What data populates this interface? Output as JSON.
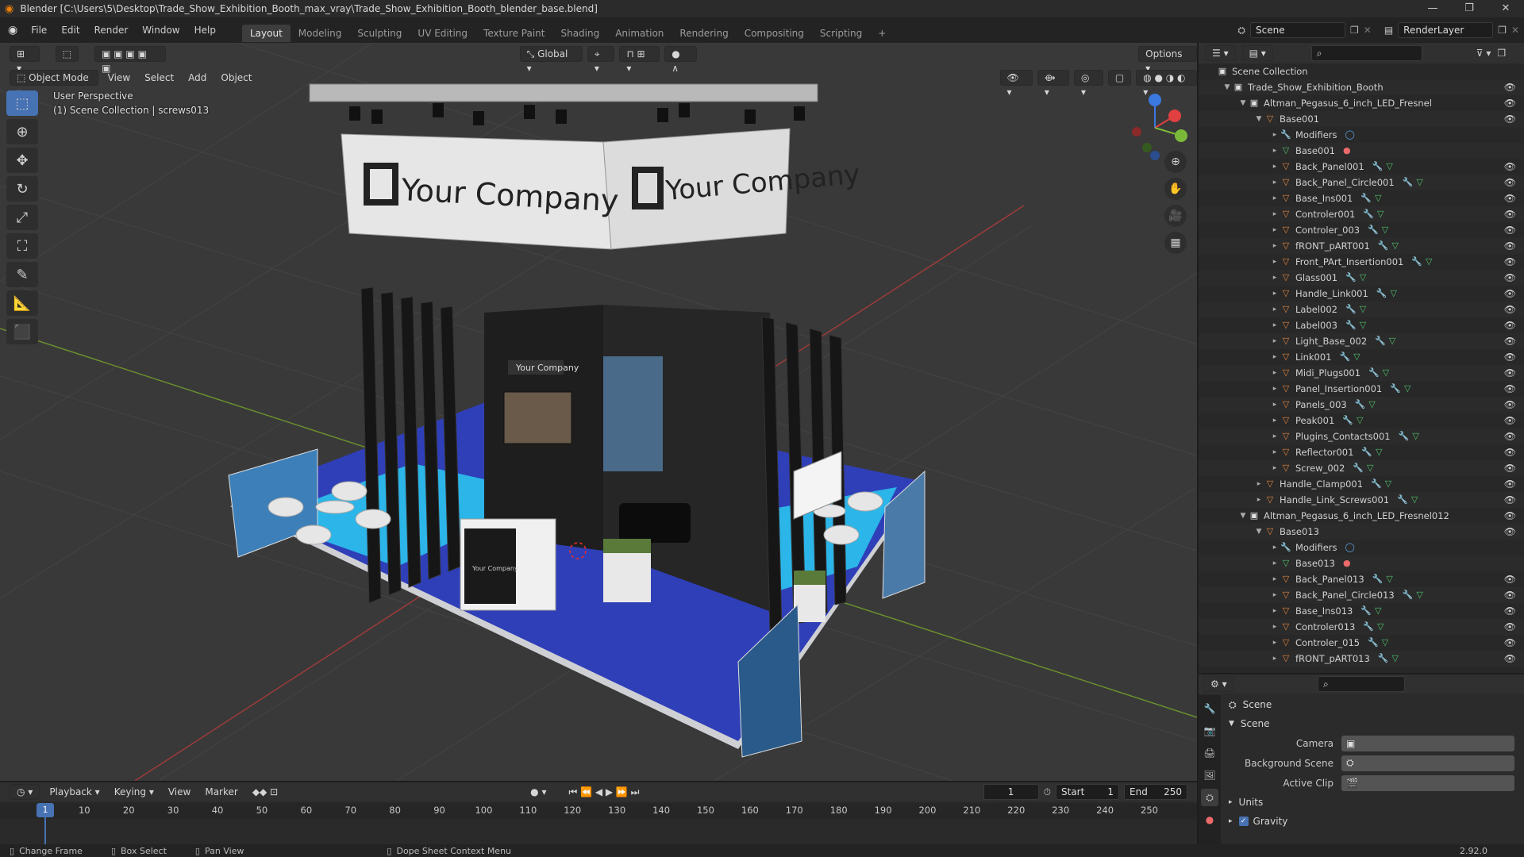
{
  "window": {
    "title": "Blender [C:\\Users\\5\\Desktop\\Trade_Show_Exhibition_Booth_max_vray\\Trade_Show_Exhibition_Booth_blender_base.blend]",
    "controls": [
      "—",
      "❐",
      "✕"
    ]
  },
  "menubar": {
    "menus": [
      "File",
      "Edit",
      "Render",
      "Window",
      "Help"
    ],
    "workspaces": [
      "Layout",
      "Modeling",
      "Sculpting",
      "UV Editing",
      "Texture Paint",
      "Shading",
      "Animation",
      "Rendering",
      "Compositing",
      "Scripting"
    ],
    "active_workspace": "Layout",
    "add_tab": "+",
    "scene": "Scene",
    "view_layer": "RenderLayer"
  },
  "viewport": {
    "transform_orientation": "Global",
    "options": "Options",
    "mode": "Object Mode",
    "menus": [
      "View",
      "Select",
      "Add",
      "Object"
    ],
    "overlay_line1": "User Perspective",
    "overlay_line2": "(1) Scene Collection | screws013",
    "banner_text_left": "Your Company",
    "banner_text_right": "Your Company",
    "sign_text": "Your Company",
    "desk_text": "Your Company"
  },
  "outliner": {
    "rows": [
      {
        "depth": 0,
        "tri": "",
        "icon": "coll",
        "label": "Scene Collection",
        "eye": false
      },
      {
        "depth": 1,
        "tri": "▼",
        "icon": "coll",
        "label": "Trade_Show_Exhibition_Booth",
        "eye": true
      },
      {
        "depth": 2,
        "tri": "▼",
        "icon": "coll",
        "label": "Altman_Pegasus_6_inch_LED_Fresnel",
        "eye": true
      },
      {
        "depth": 3,
        "tri": "▼",
        "icon": "obj",
        "label": "Base001",
        "eye": true
      },
      {
        "depth": 4,
        "tri": "▸",
        "icon": "mod",
        "label": "Modifiers",
        "eye": false,
        "badge": "mod"
      },
      {
        "depth": 4,
        "tri": "▸",
        "icon": "mesh",
        "label": "Base001",
        "eye": false,
        "badge": "mat"
      },
      {
        "depth": 4,
        "tri": "▸",
        "icon": "obj",
        "label": "Back_Panel001",
        "eye": true,
        "badge": "std"
      },
      {
        "depth": 4,
        "tri": "▸",
        "icon": "obj",
        "label": "Back_Panel_Circle001",
        "eye": true,
        "badge": "std"
      },
      {
        "depth": 4,
        "tri": "▸",
        "icon": "obj",
        "label": "Base_Ins001",
        "eye": true,
        "badge": "std"
      },
      {
        "depth": 4,
        "tri": "▸",
        "icon": "obj",
        "label": "Controler001",
        "eye": true,
        "badge": "std"
      },
      {
        "depth": 4,
        "tri": "▸",
        "icon": "obj",
        "label": "Controler_003",
        "eye": true,
        "badge": "std"
      },
      {
        "depth": 4,
        "tri": "▸",
        "icon": "obj",
        "label": "fRONT_pART001",
        "eye": true,
        "badge": "std"
      },
      {
        "depth": 4,
        "tri": "▸",
        "icon": "obj",
        "label": "Front_PArt_Insertion001",
        "eye": true,
        "badge": "std"
      },
      {
        "depth": 4,
        "tri": "▸",
        "icon": "obj",
        "label": "Glass001",
        "eye": true,
        "badge": "std"
      },
      {
        "depth": 4,
        "tri": "▸",
        "icon": "obj",
        "label": "Handle_Link001",
        "eye": true,
        "badge": "std"
      },
      {
        "depth": 4,
        "tri": "▸",
        "icon": "obj",
        "label": "Label002",
        "eye": true,
        "badge": "std"
      },
      {
        "depth": 4,
        "tri": "▸",
        "icon": "obj",
        "label": "Label003",
        "eye": true,
        "badge": "std"
      },
      {
        "depth": 4,
        "tri": "▸",
        "icon": "obj",
        "label": "Light_Base_002",
        "eye": true,
        "badge": "std"
      },
      {
        "depth": 4,
        "tri": "▸",
        "icon": "obj",
        "label": "Link001",
        "eye": true,
        "badge": "std"
      },
      {
        "depth": 4,
        "tri": "▸",
        "icon": "obj",
        "label": "Midi_Plugs001",
        "eye": true,
        "badge": "std"
      },
      {
        "depth": 4,
        "tri": "▸",
        "icon": "obj",
        "label": "Panel_Insertion001",
        "eye": true,
        "badge": "std"
      },
      {
        "depth": 4,
        "tri": "▸",
        "icon": "obj",
        "label": "Panels_003",
        "eye": true,
        "badge": "std"
      },
      {
        "depth": 4,
        "tri": "▸",
        "icon": "obj",
        "label": "Peak001",
        "eye": true,
        "badge": "std"
      },
      {
        "depth": 4,
        "tri": "▸",
        "icon": "obj",
        "label": "Plugins_Contacts001",
        "eye": true,
        "badge": "std"
      },
      {
        "depth": 4,
        "tri": "▸",
        "icon": "obj",
        "label": "Reflector001",
        "eye": true,
        "badge": "std"
      },
      {
        "depth": 4,
        "tri": "▸",
        "icon": "obj",
        "label": "Screw_002",
        "eye": true,
        "badge": "std"
      },
      {
        "depth": 3,
        "tri": "▸",
        "icon": "obj",
        "label": "Handle_Clamp001",
        "eye": true,
        "badge": "std"
      },
      {
        "depth": 3,
        "tri": "▸",
        "icon": "obj",
        "label": "Handle_Link_Screws001",
        "eye": true,
        "badge": "std"
      },
      {
        "depth": 2,
        "tri": "▼",
        "icon": "coll",
        "label": "Altman_Pegasus_6_inch_LED_Fresnel012",
        "eye": true
      },
      {
        "depth": 3,
        "tri": "▼",
        "icon": "obj",
        "label": "Base013",
        "eye": true
      },
      {
        "depth": 4,
        "tri": "▸",
        "icon": "mod",
        "label": "Modifiers",
        "eye": false,
        "badge": "mod"
      },
      {
        "depth": 4,
        "tri": "▸",
        "icon": "mesh",
        "label": "Base013",
        "eye": false,
        "badge": "mat"
      },
      {
        "depth": 4,
        "tri": "▸",
        "icon": "obj",
        "label": "Back_Panel013",
        "eye": true,
        "badge": "std"
      },
      {
        "depth": 4,
        "tri": "▸",
        "icon": "obj",
        "label": "Back_Panel_Circle013",
        "eye": true,
        "badge": "std"
      },
      {
        "depth": 4,
        "tri": "▸",
        "icon": "obj",
        "label": "Base_Ins013",
        "eye": true,
        "badge": "std"
      },
      {
        "depth": 4,
        "tri": "▸",
        "icon": "obj",
        "label": "Controler013",
        "eye": true,
        "badge": "std"
      },
      {
        "depth": 4,
        "tri": "▸",
        "icon": "obj",
        "label": "Controler_015",
        "eye": true,
        "badge": "std"
      },
      {
        "depth": 4,
        "tri": "▸",
        "icon": "obj",
        "label": "fRONT_pART013",
        "eye": true,
        "badge": "std"
      }
    ]
  },
  "properties": {
    "title": "Scene",
    "section": "Scene",
    "fields": [
      {
        "label": "Camera",
        "value": ""
      },
      {
        "label": "Background Scene",
        "value": ""
      },
      {
        "label": "Active Clip",
        "value": ""
      }
    ],
    "collapsed_sections": [
      "Units",
      "Gravity"
    ]
  },
  "timeline": {
    "menus": [
      "Playback",
      "Keying",
      "View",
      "Marker"
    ],
    "current_frame": "1",
    "start_label": "Start",
    "start": "1",
    "end_label": "End",
    "end": "250",
    "ticks": [
      "10",
      "20",
      "30",
      "40",
      "50",
      "60",
      "70",
      "80",
      "90",
      "100",
      "110",
      "120",
      "130",
      "140",
      "150",
      "160",
      "170",
      "180",
      "190",
      "200",
      "210",
      "220",
      "230",
      "240",
      "250"
    ],
    "playhead": "1"
  },
  "statusbar": {
    "items": [
      "Change Frame",
      "Box Select",
      "Pan View",
      "Dope Sheet Context Menu"
    ],
    "version": "2.92.0"
  },
  "colors": {
    "accent": "#4772b3",
    "floor_blue": "#2f3fb8",
    "floor_cyan": "#2bb5e8"
  }
}
